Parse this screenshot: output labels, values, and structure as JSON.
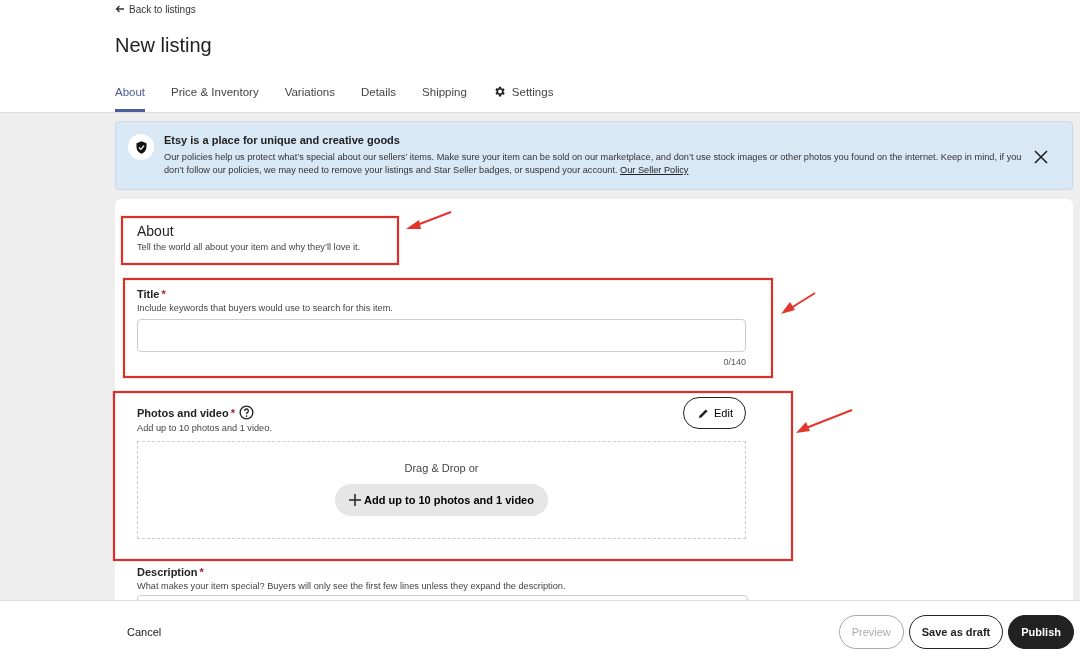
{
  "back_link": "Back to listings",
  "page_title": "New listing",
  "tabs": [
    {
      "label": "About",
      "selected": true,
      "kind": "text"
    },
    {
      "label": "Price & Inventory",
      "selected": false,
      "kind": "text"
    },
    {
      "label": "Variations",
      "selected": false,
      "kind": "text"
    },
    {
      "label": "Details",
      "selected": false,
      "kind": "text"
    },
    {
      "label": "Shipping",
      "selected": false,
      "kind": "text"
    },
    {
      "label": "Settings",
      "selected": false,
      "kind": "gear"
    }
  ],
  "notice": {
    "title": "Etsy is a place for unique and creative goods",
    "body": "Our policies help us protect what’s special about our sellers’ items. Make sure your item can be sold on our marketplace, and don’t use stock images or other photos you found on the internet. Keep in mind, if you don’t follow our policies, we may need to remove your listings and Star Seller badges, or suspend your account.",
    "link": "Our Seller Policy"
  },
  "about": {
    "heading": "About",
    "subtitle": "Tell the world all about your item and why they’ll love it."
  },
  "title_field": {
    "label": "Title",
    "required_mark": "*",
    "hint": "Include keywords that buyers would use to search for this item.",
    "counter": "0/140"
  },
  "photos": {
    "label": "Photos and video",
    "required_mark": "*",
    "hint": "Add up to 10 photos and 1 video.",
    "edit_button": "Edit",
    "drop_text": "Drag & Drop or",
    "add_button": "Add up to 10 photos and 1 video"
  },
  "description": {
    "label": "Description",
    "required_mark": "*",
    "hint": "What makes your item special? Buyers will only see the first few lines unless they expand the description."
  },
  "footer": {
    "cancel": "Cancel",
    "buttons": [
      {
        "label": "Preview",
        "kind": "secondary",
        "disabled": true
      },
      {
        "label": "Save as draft",
        "kind": "secondary",
        "disabled": false
      },
      {
        "label": "Publish",
        "kind": "primary",
        "disabled": false
      }
    ]
  }
}
